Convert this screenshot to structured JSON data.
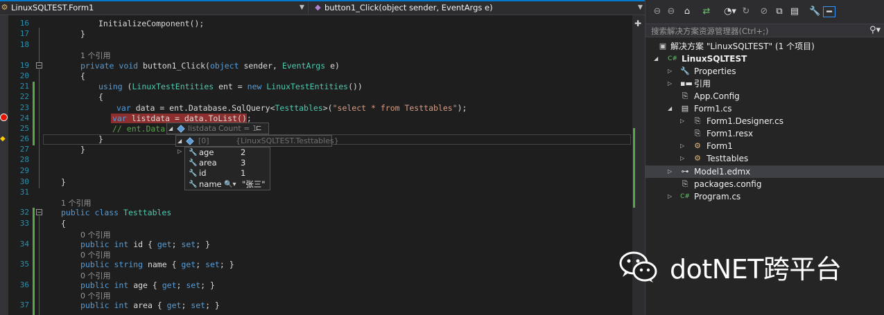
{
  "nav": {
    "left_dropdown": "LinuxSQLTEST.Form1",
    "right_dropdown": "button1_Click(object sender, EventArgs e)"
  },
  "line_numbers": [
    "16",
    "17",
    "18",
    "19",
    "20",
    "21",
    "22",
    "23",
    "24",
    "25",
    "26",
    "27",
    "28",
    "29",
    "30",
    "31",
    "32",
    "33",
    "34",
    "35",
    "36",
    "37"
  ],
  "code": {
    "l16": "InitializeComponent();",
    "l17": "}",
    "ref_button": "1 个引用",
    "l19_kw1": "private",
    "l19_kw2": "void",
    "l19_name": " button1_Click(",
    "l19_kw3": "object",
    "l19_mid": " sender, ",
    "l19_type": "EventArgs",
    "l19_end": " e)",
    "l20": "{",
    "l21_kw": "using",
    "l21_a": " (",
    "l21_type": "LinuxTestEntities",
    "l21_b": " ent = ",
    "l21_kw2": "new",
    "l21_type2": "LinuxTestEntities",
    "l21_c": "())",
    "l22": "{",
    "l23_kw": "var",
    "l23_a": " data = ent.Database.SqlQuery<",
    "l23_type": "Testtables",
    "l23_b": ">(",
    "l23_str": "\"select * from Testtables\"",
    "l23_c": ");",
    "l24_kw": "var",
    "l24_a": " listdata = data.ToList();",
    "l25_cm": "// ent.Data",
    "l26": "}",
    "l27": "}",
    "l30": "}",
    "ref_class": "1 个引用",
    "l32_kw1": "public",
    "l32_kw2": "class",
    "l32_type": "Testtables",
    "l33": "{",
    "ref0": "0 个引用",
    "ref1": "0 个引用",
    "ref2": "0 个引用",
    "ref3": "0 个引用",
    "ref4": "0 个引用",
    "p_public": "public",
    "p_int": "int",
    "p_string": "string",
    "p_get": "get",
    "p_set": "set",
    "p_id": " id { ",
    "p_name": " name { ",
    "p_age": " age { ",
    "p_area": " area { ",
    "p_semi": "; ",
    "p_close": "; }"
  },
  "tooltip": {
    "row1_label": "listdata",
    "row1_count": "Count = 1",
    "row2_index": "[0]",
    "row2_value": "{LinuxSQLTEST.Testtables}",
    "members": [
      {
        "name": "age",
        "value": "2"
      },
      {
        "name": "area",
        "value": "3"
      },
      {
        "name": "id",
        "value": "1"
      },
      {
        "name": "name",
        "value": "\"张三\""
      }
    ]
  },
  "solution_explorer": {
    "search_placeholder": "搜索解决方案资源管理器(Ctrl+;)",
    "items": [
      {
        "label": "解决方案 \"LinuxSQLTEST\" (1 个项目)"
      },
      {
        "label": "LinuxSQLTEST"
      },
      {
        "label": "Properties"
      },
      {
        "label": "引用"
      },
      {
        "label": "App.Config"
      },
      {
        "label": "Form1.cs"
      },
      {
        "label": "Form1.Designer.cs"
      },
      {
        "label": "Form1.resx"
      },
      {
        "label": "Form1"
      },
      {
        "label": "Testtables"
      },
      {
        "label": "Model1.edmx"
      },
      {
        "label": "packages.config"
      },
      {
        "label": "Program.cs"
      }
    ]
  },
  "watermark": {
    "text": "dotNET跨平台"
  },
  "colors": {
    "keyword": "#569cd6",
    "type": "#4ec9b0",
    "string": "#d69d85",
    "comment": "#57a64a",
    "line_number": "#2b91af",
    "breakpoint_highlight": "#8e2f2f",
    "accent": "#007acc"
  }
}
